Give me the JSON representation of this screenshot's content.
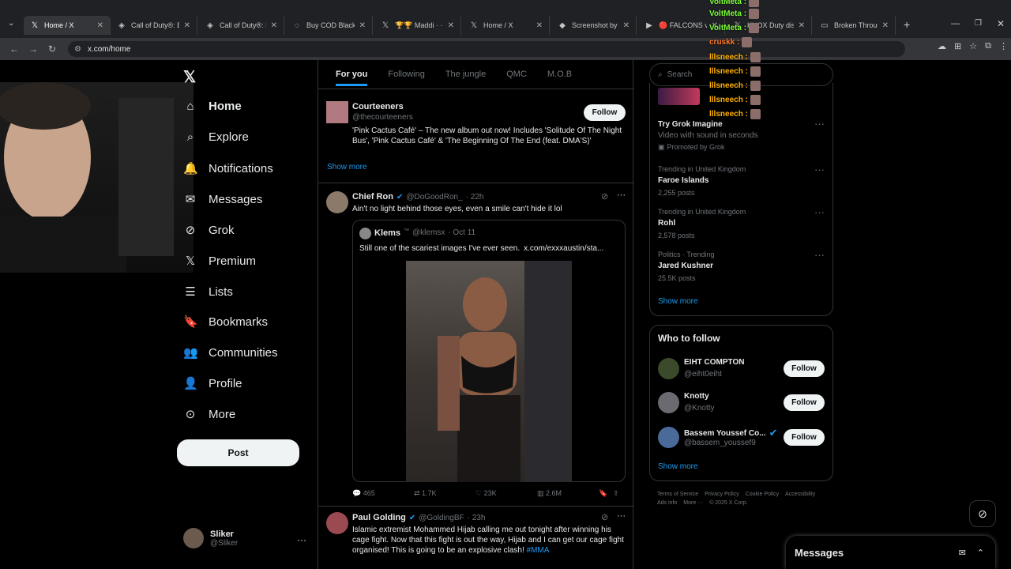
{
  "browser": {
    "tabs": [
      {
        "title": "Home / X",
        "icon": "x-icon",
        "active": true
      },
      {
        "title": "Call of Duty®: Bla",
        "icon": "cod-icon"
      },
      {
        "title": "Call of Duty®: Bla",
        "icon": "cod-icon"
      },
      {
        "title": "Buy COD Black O",
        "icon": "loading-icon"
      },
      {
        "title": "🏆🏆 Maddi · ·",
        "icon": "x-icon"
      },
      {
        "title": "Home / X",
        "icon": "x-icon"
      },
      {
        "title": "Screenshot by Lig",
        "icon": "lightshot-icon"
      },
      {
        "title": "🔴 FALCONS vs V",
        "icon": "youtube-icon"
      },
      {
        "title": "KNOX Duty dis",
        "icon": "x-icon"
      },
      {
        "title": "Broken Through",
        "icon": "page-icon"
      }
    ],
    "url": "x.com/home"
  },
  "nav": {
    "items": [
      "Home",
      "Explore",
      "Notifications",
      "Messages",
      "Grok",
      "Premium",
      "Lists",
      "Bookmarks",
      "Communities",
      "Profile",
      "More"
    ],
    "post_label": "Post",
    "account_name": "Sliker",
    "account_handle": "@Sliker"
  },
  "feed": {
    "tabs": [
      "For you",
      "Following",
      "The jungle",
      "QMC",
      "M.O.B"
    ],
    "post1": {
      "name": "Courteeners",
      "handle": "@thecourteeners",
      "follow": "Follow",
      "text": "'Pink Cactus Café' – The new album out now! Includes 'Solitude Of The Night Bus', 'Pink Cactus Café' & 'The Beginning Of The End (feat. DMA'S)'",
      "show_more": "Show more"
    },
    "post2": {
      "name": "Chief Ron",
      "handle": "@DoGoodRon_",
      "time": "· 22h",
      "text": "Ain't no light behind those eyes, even a smile can't hide it lol",
      "quote": {
        "name": "Klems",
        "tm": "™",
        "handle": "@klemsx",
        "time": "· Oct 11",
        "text": "Still one of the scariest images I've ever seen.",
        "link": "x.com/exxxaustin/sta..."
      },
      "stats": {
        "replies": "465",
        "reposts": "1.7K",
        "likes": "23K",
        "views": "2.6M"
      }
    },
    "post3": {
      "name": "Paul Golding",
      "handle": "@GoldingBF",
      "time": "· 23h",
      "text": "Islamic extremist Mohammed Hijab calling me out tonight after winning his cage fight. Now that this fight is out the way, Hijab and I can get our cage fight organised! This is going to be an explosive clash!",
      "hashtag": "#MMA"
    }
  },
  "right": {
    "search_placeholder": "Search",
    "promo": {
      "title": "Try Grok Imagine",
      "sub": "Video with sound in seconds",
      "promoted": "Promoted by Grok"
    },
    "trends": [
      {
        "context": "Trending in United Kingdom",
        "name": "Faroe Islands",
        "posts": "2,255 posts"
      },
      {
        "context": "Trending in United Kingdom",
        "name": "Rohl",
        "posts": "2,578 posts"
      },
      {
        "context": "Politics · Trending",
        "name": "Jared Kushner",
        "posts": "25.5K posts"
      }
    ],
    "show_more": "Show more",
    "who_title": "Who to follow",
    "who": [
      {
        "name": "EIHT COMPTON",
        "handle": "@eiht0eiht",
        "verified": false
      },
      {
        "name": "Knotty",
        "handle": "@Knotty",
        "verified": false
      },
      {
        "name": "Bassem Youssef Co...",
        "handle": "@bassem_youssef9",
        "verified": true
      }
    ],
    "follow": "Follow",
    "footer": [
      "Terms of Service",
      "Privacy Policy",
      "Cookie Policy",
      "Accessibility",
      "Ads info",
      "More ···",
      "© 2025 X Corp."
    ]
  },
  "messages_label": "Messages",
  "chat_overlay": [
    {
      "user": "VoltMeta :",
      "color": "#7cfc3a"
    },
    {
      "user": "VoltMeta :",
      "color": "#7cfc3a"
    },
    {
      "user": "VoltMeta :",
      "color": "#7cfc3a"
    },
    {
      "user": "cruskk :",
      "color": "#ff7a2a"
    },
    {
      "user": "lllsneech :",
      "color": "#ffb000"
    },
    {
      "user": "lllsneech :",
      "color": "#ffb000"
    },
    {
      "user": "lllsneech :",
      "color": "#ffb000"
    },
    {
      "user": "lllsneech :",
      "color": "#ffb000"
    },
    {
      "user": "lllsneech :",
      "color": "#ffb000"
    }
  ],
  "colors": {
    "accent": "#1d9bf0",
    "bg": "#000000",
    "border": "#2f3336"
  }
}
